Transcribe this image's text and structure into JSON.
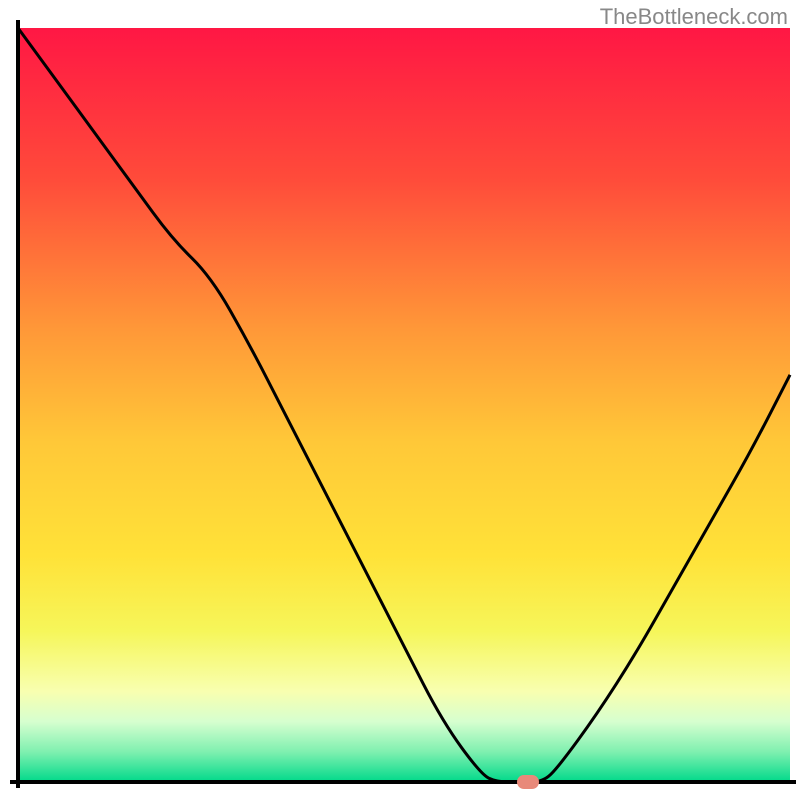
{
  "watermark": "TheBottleneck.com",
  "chart_data": {
    "type": "line",
    "title": "",
    "xlabel": "",
    "ylabel": "",
    "xlim": [
      0,
      100
    ],
    "ylim": [
      0,
      100
    ],
    "x": [
      0,
      5,
      10,
      15,
      20,
      25,
      30,
      35,
      40,
      45,
      50,
      55,
      60,
      62,
      65,
      68,
      70,
      75,
      80,
      85,
      90,
      95,
      100
    ],
    "values": [
      100,
      93,
      86,
      79,
      72,
      67,
      58,
      48,
      38,
      28,
      18,
      8,
      1,
      0,
      0,
      0,
      2,
      9,
      17,
      26,
      35,
      44,
      54
    ],
    "marker": {
      "x": 66,
      "y": 0
    },
    "gradient_stops": [
      {
        "offset": 0,
        "color": "#ff1744"
      },
      {
        "offset": 0.2,
        "color": "#ff4b3a"
      },
      {
        "offset": 0.4,
        "color": "#ff9838"
      },
      {
        "offset": 0.55,
        "color": "#ffc838"
      },
      {
        "offset": 0.7,
        "color": "#ffe238"
      },
      {
        "offset": 0.8,
        "color": "#f6f65a"
      },
      {
        "offset": 0.88,
        "color": "#f8ffb0"
      },
      {
        "offset": 0.92,
        "color": "#d6ffcf"
      },
      {
        "offset": 0.96,
        "color": "#7ff0b0"
      },
      {
        "offset": 1.0,
        "color": "#00d98a"
      }
    ],
    "line_color": "#000000",
    "axis_color": "#000000"
  }
}
